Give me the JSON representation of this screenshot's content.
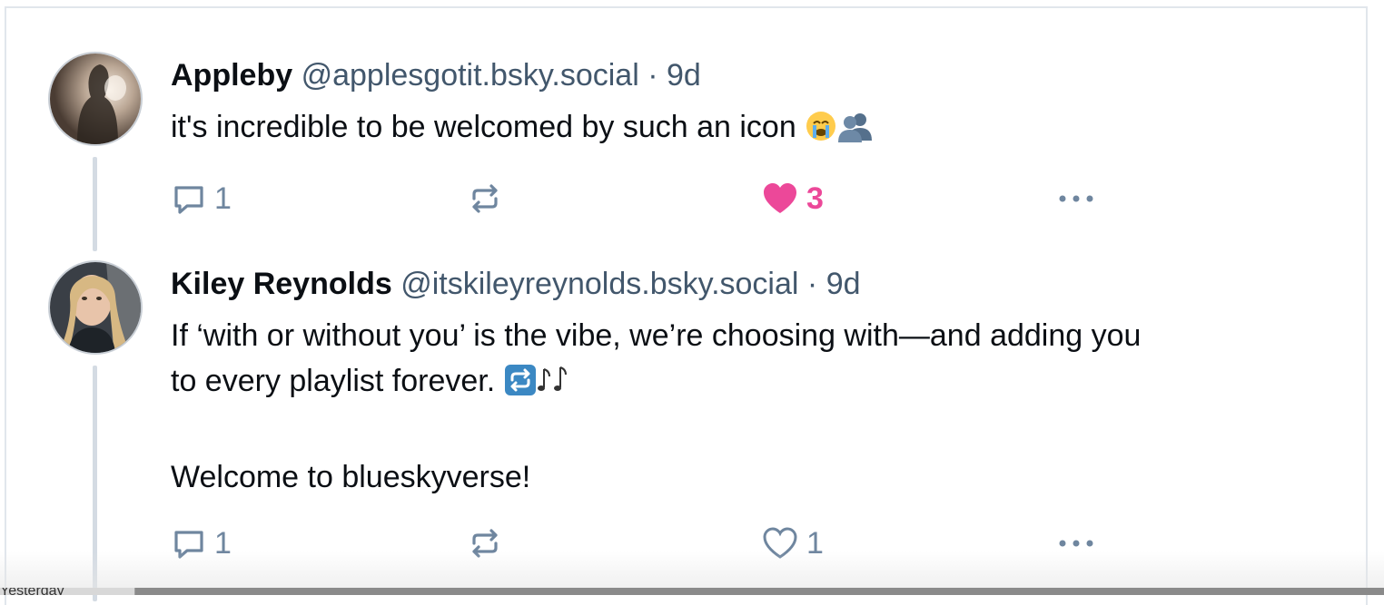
{
  "posts": [
    {
      "display_name": "Appleby",
      "handle": "@applesgotit.bsky.social",
      "separator": "·",
      "time": "9d",
      "text": "it's incredible to be welcomed by such an icon",
      "emoji": [
        "loudly-crying-face",
        "busts-in-silhouette"
      ],
      "reply_count": "1",
      "like_count": "3",
      "liked": true
    },
    {
      "display_name": "Kiley Reynolds",
      "handle": "@itskileyreynolds.bsky.social",
      "separator": "·",
      "time": "9d",
      "text_line1": "If ‘with or without you’ is the vibe, we’re choosing with—and adding you",
      "text_line2": "to every playlist forever.",
      "text_line3": "Welcome to blueskyverse!",
      "emoji": [
        "repeat-button",
        "musical-notes"
      ],
      "reply_count": "1",
      "like_count": "1",
      "liked": false
    }
  ],
  "bottom_tab_label": "Yesterday",
  "colors": {
    "text": "#0b0f14",
    "muted": "#42576c",
    "icon": "#6f869f",
    "like": "#ec4899",
    "thread_line": "#d4dbe3"
  }
}
